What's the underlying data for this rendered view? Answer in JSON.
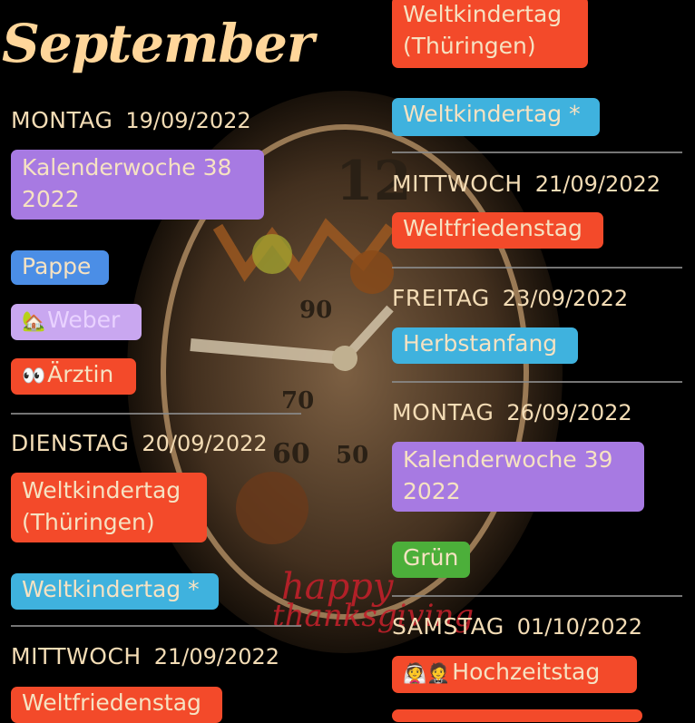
{
  "month_title": "September",
  "left_column": {
    "days": [
      {
        "name": "MONTAG",
        "date": "19/09/2022"
      },
      {
        "name": "DIENSTAG",
        "date": "20/09/2022"
      },
      {
        "name": "MITTWOCH",
        "date": "21/09/2022"
      }
    ],
    "events": {
      "kw38": "Kalenderwoche 38 2022",
      "pappe": "Pappe",
      "weber": "Weber",
      "aerztin": "Ärztin",
      "weltkindertag_th": "Weltkindertag (Thüringen)",
      "weltkindertag": "Weltkindertag *",
      "weltfriedenstag": "Weltfriedenstag"
    }
  },
  "right_column": {
    "days": [
      {
        "name": "MITTWOCH",
        "date": "21/09/2022"
      },
      {
        "name": "FREITAG",
        "date": "23/09/2022"
      },
      {
        "name": "MONTAG",
        "date": "26/09/2022"
      },
      {
        "name": "SAMSTAG",
        "date": "01/10/2022"
      }
    ],
    "events": {
      "weltkindertag_th": "Weltkindertag (Thüringen)",
      "weltkindertag": "Weltkindertag *",
      "weltfriedenstag": "Weltfriedenstag",
      "herbstanfang": "Herbstanfang",
      "kw39": "Kalenderwoche 39 2022",
      "gruen": "Grün",
      "hochzeitstag": "Hochzeitstag"
    }
  },
  "icons": {
    "weber": "house-with-tree-icon",
    "aerztin": "eyes-icon",
    "hochzeitstag": "bride-and-groom-icon"
  },
  "colors": {
    "red": "#f34a2a",
    "purple": "#a77ae2",
    "blue": "#4b8ee6",
    "lavender": "#c9a7f0",
    "cyan": "#3fb2de",
    "green": "#4caf3a",
    "text": "#f3dcb5"
  }
}
